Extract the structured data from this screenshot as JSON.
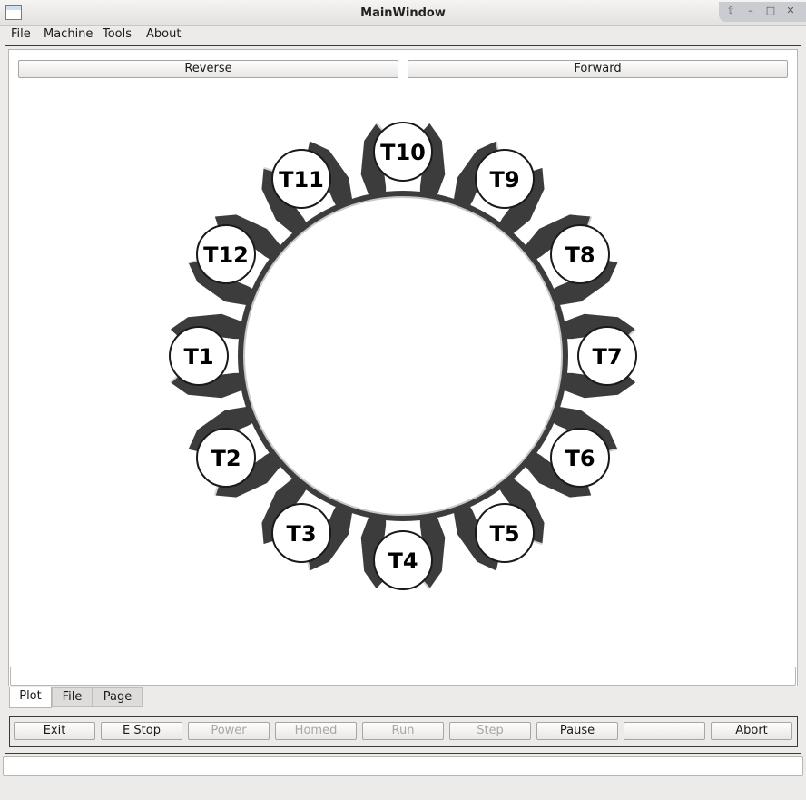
{
  "window": {
    "title": "MainWindow",
    "icon": "app-window-icon"
  },
  "menu": [
    "File",
    "Machine",
    "Tools",
    "About"
  ],
  "toolbar": {
    "reverse_label": "Reverse",
    "forward_label": "Forward"
  },
  "turret": {
    "tools": [
      "T1",
      "T2",
      "T3",
      "T4",
      "T5",
      "T6",
      "T7",
      "T8",
      "T9",
      "T10",
      "T11",
      "T12"
    ]
  },
  "tabs": [
    "Plot",
    "File",
    "Page"
  ],
  "buttons": [
    {
      "label": "Exit",
      "enabled": true
    },
    {
      "label": "E Stop",
      "enabled": true
    },
    {
      "label": "Power",
      "enabled": false
    },
    {
      "label": "Homed",
      "enabled": false
    },
    {
      "label": "Run",
      "enabled": false
    },
    {
      "label": "Step",
      "enabled": false
    },
    {
      "label": "Pause",
      "enabled": true
    },
    {
      "label": "",
      "enabled": true
    },
    {
      "label": "Abort",
      "enabled": true
    }
  ],
  "colors": {
    "turret_body": "#3c3c3c",
    "window_bg": "#edebe9"
  }
}
